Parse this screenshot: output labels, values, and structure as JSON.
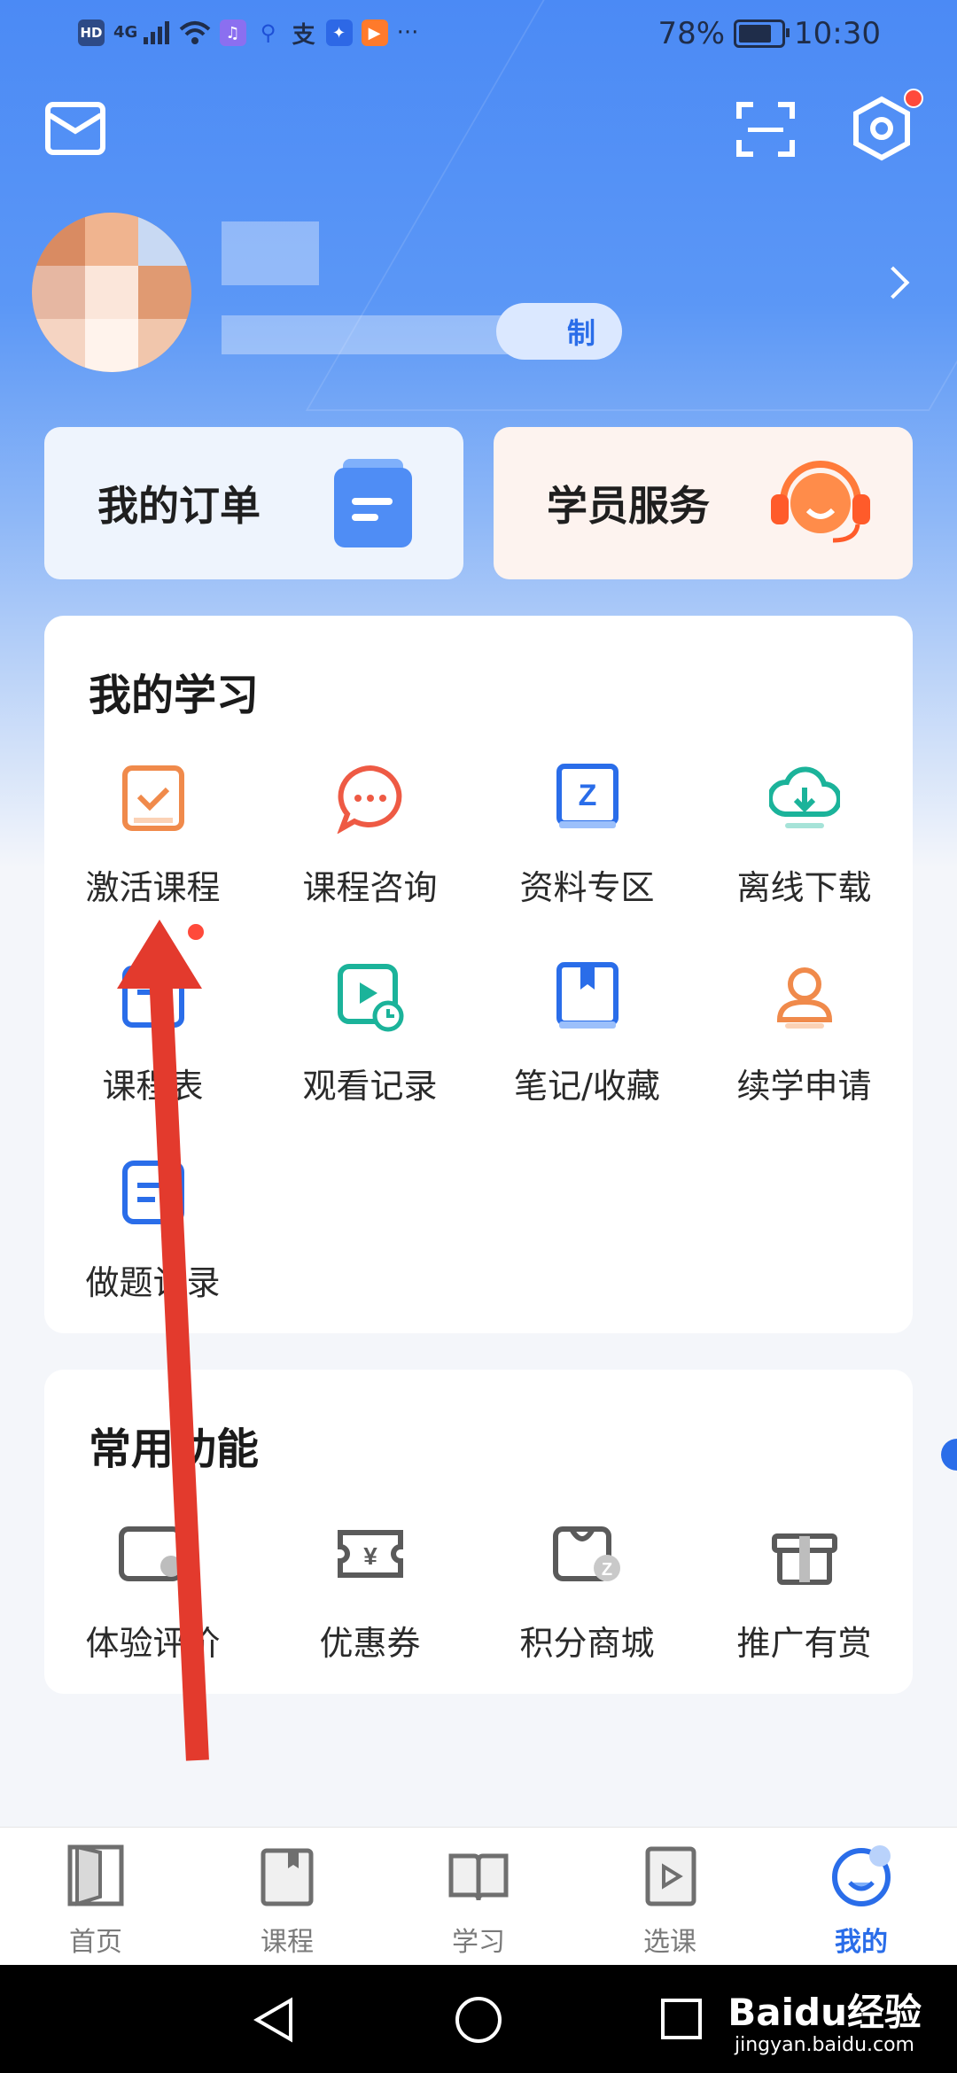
{
  "status_bar": {
    "left_icons": [
      "hd-icon",
      "signal-4g-icon",
      "wifi-icon",
      "music-app-icon",
      "search-app-icon",
      "alipay-icon",
      "bulb-app-icon",
      "video-app-icon",
      "more-icon"
    ],
    "hd_label": "HD",
    "net_label": "4G",
    "more_label": "···",
    "battery": "78%",
    "time": "10:30"
  },
  "header": {
    "inbox_icon": "mail-icon",
    "scan_icon": "scan-icon",
    "settings_icon": "settings-hex-icon"
  },
  "profile": {
    "member_badge": "制"
  },
  "quick_cards": [
    {
      "title": "我的订单",
      "icon": "order-icon"
    },
    {
      "title": "学员服务",
      "icon": "customer-service-icon"
    }
  ],
  "my_study": {
    "title": "我的学习",
    "items": [
      {
        "label": "激活课程",
        "icon": "activate-course-icon"
      },
      {
        "label": "课程咨询",
        "icon": "chat-bubble-icon"
      },
      {
        "label": "资料专区",
        "icon": "book-z-icon"
      },
      {
        "label": "离线下载",
        "icon": "cloud-download-icon"
      },
      {
        "label": "课程表",
        "icon": "schedule-icon"
      },
      {
        "label": "观看记录",
        "icon": "watch-history-icon"
      },
      {
        "label": "笔记/收藏",
        "icon": "bookmark-book-icon"
      },
      {
        "label": "续学申请",
        "icon": "user-apply-icon"
      },
      {
        "label": "做题记录",
        "icon": "quiz-record-icon"
      }
    ]
  },
  "common": {
    "title": "常用功能",
    "items": [
      {
        "label": "体验评价",
        "icon": "review-card-icon"
      },
      {
        "label": "优惠券",
        "icon": "coupon-icon"
      },
      {
        "label": "积分商城",
        "icon": "points-bag-icon"
      },
      {
        "label": "推广有赏",
        "icon": "gift-icon"
      }
    ]
  },
  "tabbar": [
    {
      "label": "首页",
      "icon": "home-door-icon"
    },
    {
      "label": "课程",
      "icon": "course-book-icon"
    },
    {
      "label": "学习",
      "icon": "open-book-icon"
    },
    {
      "label": "选课",
      "icon": "play-card-icon"
    },
    {
      "label": "我的",
      "icon": "profile-face-icon"
    }
  ],
  "watermark": {
    "brand": "Baidu经验",
    "url": "jingyan.baidu.com"
  },
  "colors": {
    "accent": "#2a6de9",
    "arrow": "#e33a2d",
    "header": "#4b8af5"
  }
}
